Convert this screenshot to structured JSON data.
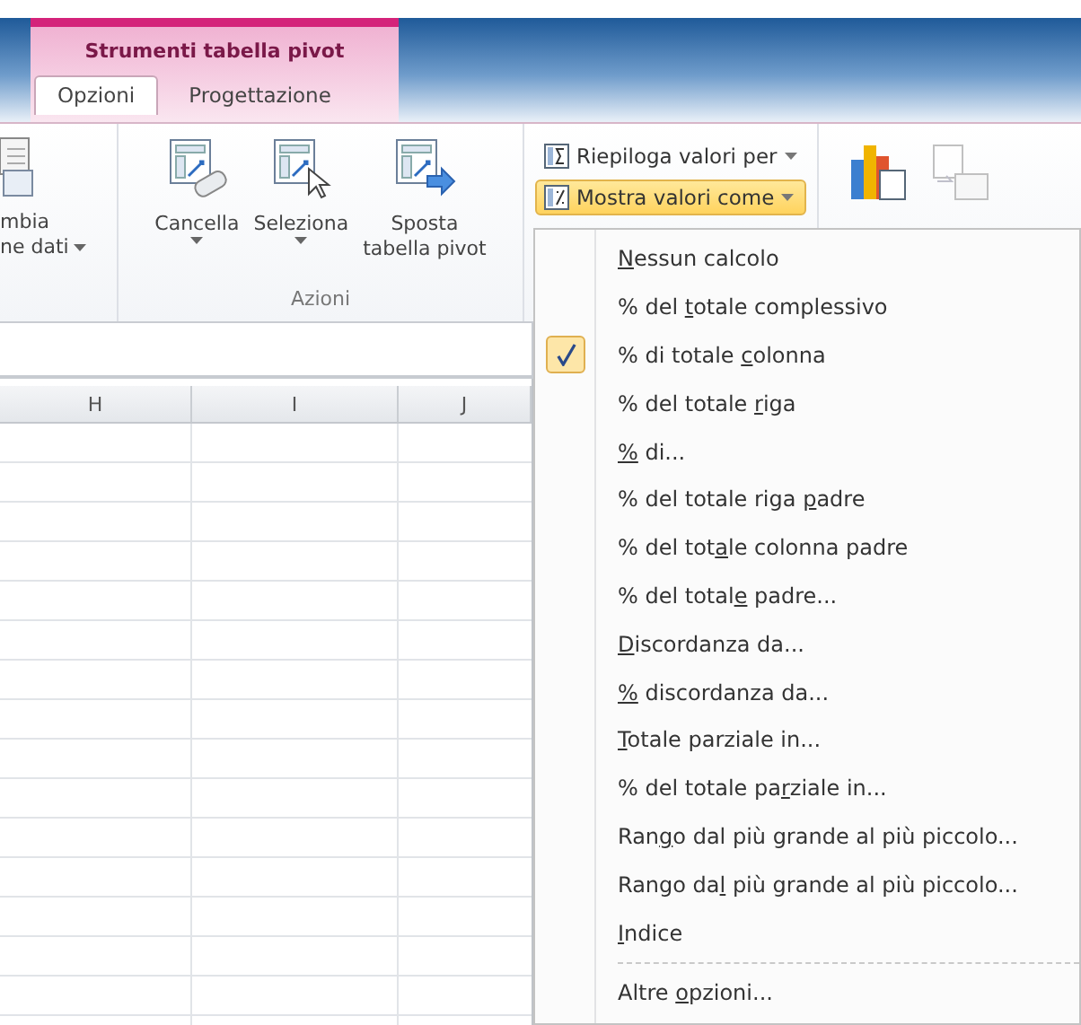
{
  "context_group": {
    "title": "Strumenti tabella pivot"
  },
  "tabs": [
    {
      "label": "Opzioni",
      "selected": true
    },
    {
      "label": "Progettazione",
      "selected": false
    }
  ],
  "ribbon": {
    "partial_button": {
      "lines": [
        "mbia",
        "ne dati"
      ],
      "dropdown": true
    },
    "azioni": {
      "label": "Azioni",
      "buttons": [
        {
          "kind": "clear",
          "lines": [
            "Cancella"
          ],
          "dropdown": true
        },
        {
          "kind": "select",
          "lines": [
            "Seleziona"
          ],
          "dropdown": true
        },
        {
          "kind": "move",
          "lines": [
            "Sposta",
            "tabella pivot"
          ],
          "dropdown": false
        }
      ]
    },
    "small_buttons": [
      {
        "kind": "summarize",
        "label": "Riepiloga valori per",
        "highlighted": false
      },
      {
        "kind": "show",
        "label": "Mostra valori come",
        "highlighted": true
      }
    ]
  },
  "columns": [
    "H",
    "I",
    "J"
  ],
  "menu": {
    "items": [
      {
        "kind": "option",
        "key": "N",
        "after": "essun calcolo",
        "checked": false
      },
      {
        "kind": "option",
        "before": "% del ",
        "key": "t",
        "after": "otale complessivo",
        "checked": false
      },
      {
        "kind": "option",
        "before": "% di totale ",
        "key": "c",
        "after": "olonna",
        "checked": true
      },
      {
        "kind": "option",
        "before": "% del totale ",
        "key": "r",
        "after": "iga",
        "checked": false
      },
      {
        "kind": "option",
        "key": "%",
        "after": " di...",
        "checked": false
      },
      {
        "kind": "option",
        "before": "% del totale riga ",
        "key": "p",
        "after": "adre",
        "checked": false
      },
      {
        "kind": "option",
        "before": "% del tot",
        "key": "a",
        "after": "le colonna padre",
        "checked": false
      },
      {
        "kind": "option",
        "before": "% del total",
        "key": "e",
        "after": " padre...",
        "checked": false
      },
      {
        "kind": "option",
        "key": "D",
        "after": "iscordanza da...",
        "checked": false
      },
      {
        "kind": "option",
        "key": "%",
        "after": " discordanza da...",
        "checked": false
      },
      {
        "kind": "option",
        "key": "T",
        "after": "otale parziale in...",
        "checked": false
      },
      {
        "kind": "option",
        "before": "% del totale pa",
        "key": "r",
        "after": "ziale in...",
        "checked": false
      },
      {
        "kind": "option",
        "before": "Ran",
        "key": "g",
        "after": "o dal più grande al più piccolo...",
        "checked": false
      },
      {
        "kind": "option",
        "before": "Rango da",
        "key": "l",
        "after": " più grande al più piccolo...",
        "checked": false
      },
      {
        "kind": "option",
        "key": "I",
        "after": "ndice",
        "checked": false
      },
      {
        "kind": "separator"
      },
      {
        "kind": "option",
        "before": "Altre ",
        "key": "o",
        "after": "pzioni...",
        "checked": false
      }
    ]
  }
}
